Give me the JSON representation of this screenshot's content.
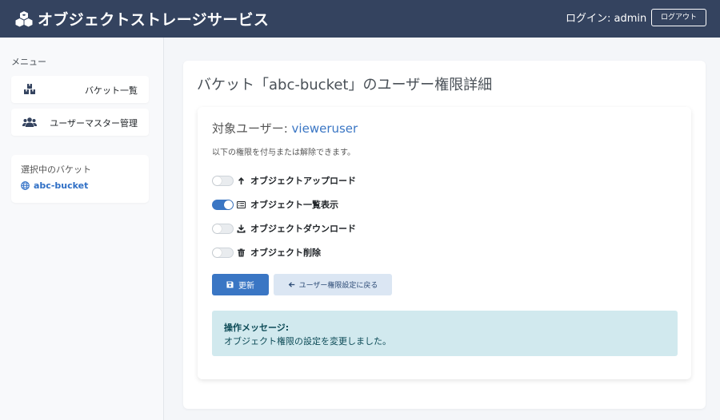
{
  "header": {
    "title": "オブジェクトストレージサービス",
    "login_text": "ログイン: admin",
    "logout_label": "ログアウト",
    "brand_icon": "cubes-icon",
    "bg_color": "#34435f"
  },
  "sidebar": {
    "menu_label": "メニュー",
    "items": [
      {
        "label": "バケット一覧",
        "icon": "boxes-icon"
      },
      {
        "label": "ユーザーマスター管理",
        "icon": "users-icon"
      }
    ],
    "selected_heading": "選択中のバケット",
    "selected_bucket": "abc-bucket",
    "selected_icon": "globe-icon"
  },
  "main": {
    "title": "バケット「abc-bucket」のユーザー権限詳細",
    "target_user_label": "対象ユーザー:",
    "target_user_name": "vieweruser",
    "description": "以下の権限を付与または解除できます。",
    "permissions": [
      {
        "label": "オブジェクトアップロード",
        "enabled": false,
        "icon": "arrow-up-icon"
      },
      {
        "label": "オブジェクト一覧表示",
        "enabled": true,
        "icon": "list-icon"
      },
      {
        "label": "オブジェクトダウンロード",
        "enabled": false,
        "icon": "download-icon"
      },
      {
        "label": "オブジェクト削除",
        "enabled": false,
        "icon": "trash-icon"
      }
    ],
    "update_label": "更新",
    "back_label": "ユーザー権限設定に戻る",
    "alert_title": "操作メッセージ:",
    "alert_message": "オブジェクト権限の設定を変更しました。",
    "accent_color": "#3a76c4"
  }
}
